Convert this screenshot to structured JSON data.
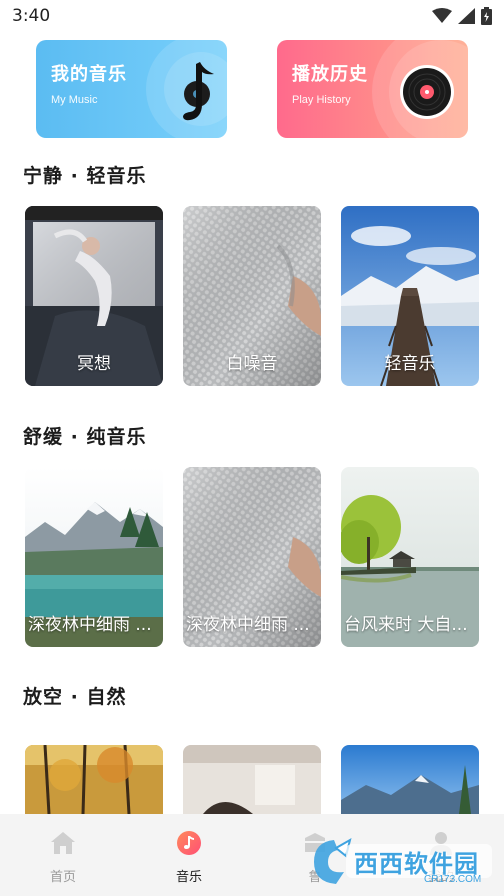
{
  "status": {
    "time": "3:40",
    "icons": [
      "wifi-icon",
      "signal-icon",
      "battery-icon"
    ]
  },
  "top_cards": [
    {
      "title": "我的音乐",
      "subtitle": "My Music",
      "icon": "music-note-disc-icon",
      "color_from": "#5bbcf2",
      "color_to": "#79d0fb"
    },
    {
      "title": "播放历史",
      "subtitle": "Play History",
      "icon": "vinyl-record-icon",
      "color_from": "#ff6a8c",
      "color_to": "#ffa689"
    }
  ],
  "sections": [
    {
      "title": "宁静 · 轻音乐",
      "tiles": [
        {
          "label": "冥想",
          "image": "person-lying-on-bed"
        },
        {
          "label": "白噪音",
          "image": "knitted-blanket"
        },
        {
          "label": "轻音乐",
          "image": "wooden-pier-snow-mountains"
        }
      ]
    },
    {
      "title": "舒缓 · 纯音乐",
      "tiles": [
        {
          "label": "深夜林中细雨 ...",
          "image": "mountain-lake-forest"
        },
        {
          "label": "深夜林中细雨 ...",
          "image": "knitted-blanket"
        },
        {
          "label": "台风来时 大自...",
          "image": "lake-pavilion-willow"
        }
      ]
    },
    {
      "title": "放空 · 自然",
      "tiles": [
        {
          "label": "",
          "image": "autumn-forest"
        },
        {
          "label": "",
          "image": "room-interior"
        },
        {
          "label": "",
          "image": "blue-sky-mountains"
        }
      ]
    }
  ],
  "nav": [
    {
      "label": "首页",
      "icon": "home-icon",
      "active": false
    },
    {
      "label": "音乐",
      "icon": "music-icon",
      "active": true
    },
    {
      "label": "鲁",
      "icon": "box-icon",
      "active": false
    },
    {
      "label": "我的",
      "icon": "user-icon",
      "active": false
    }
  ],
  "watermark": {
    "brand": "西西软件园",
    "site": "CR173.COM"
  },
  "colors": {
    "accent": "#ff5a6e",
    "nav_bg": "#f4f4f4",
    "inactive": "#9a9a9a"
  }
}
